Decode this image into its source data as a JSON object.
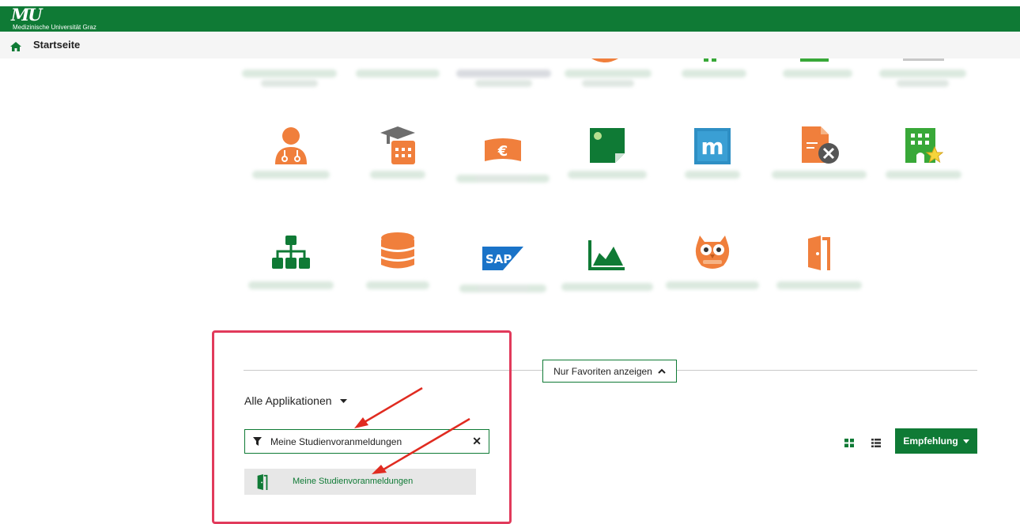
{
  "header": {
    "logo_mark": "MU",
    "logo_text": "Medizinische Universität Graz",
    "brand_color": "#0f7a35"
  },
  "breadcrumb": {
    "home_icon": "home-icon",
    "label": "Startseite"
  },
  "favorites_toggle": {
    "label": "Nur Favoriten anzeigen",
    "icon": "chevron-up-icon"
  },
  "apps_section": {
    "dropdown_label": "Alle Applikationen",
    "filter": {
      "icon": "filter-icon",
      "value": "Meine Studienvoranmeldungen",
      "clear_icon": "close-icon"
    },
    "results": [
      {
        "label": "Meine Studienvoranmeldungen",
        "icon": "door-icon"
      }
    ]
  },
  "toolbar": {
    "grid_view_icon": "grid-view-icon",
    "list_view_icon": "list-view-icon",
    "recommend_label": "Empfehlung"
  },
  "tiles": {
    "row2": [
      {
        "icon": "doctor-icon",
        "color": "#f07f3c"
      },
      {
        "icon": "graduation-calendar-icon",
        "color": "#f07f3c"
      },
      {
        "icon": "euro-banknote-icon",
        "color": "#f07f3c"
      },
      {
        "icon": "sticky-note-icon",
        "color": "#0f7a35"
      },
      {
        "icon": "m-app-icon",
        "color": "#2e8fc4"
      },
      {
        "icon": "document-settings-icon",
        "color": "#f07f3c"
      },
      {
        "icon": "building-star-icon",
        "color": "#38a838"
      }
    ],
    "row3": [
      {
        "icon": "org-chart-icon",
        "color": "#0f7a35"
      },
      {
        "icon": "database-icon",
        "color": "#f07f3c"
      },
      {
        "icon": "sap-logo-icon",
        "color": "#1a73c8"
      },
      {
        "icon": "area-chart-icon",
        "color": "#0f7a35"
      },
      {
        "icon": "owl-icon",
        "color": "#f07f3c"
      },
      {
        "icon": "door-icon",
        "color": "#f07f3c"
      }
    ]
  },
  "annotations": {
    "highlight_color": "#e13a5b",
    "arrow_color": "#e02b20"
  }
}
